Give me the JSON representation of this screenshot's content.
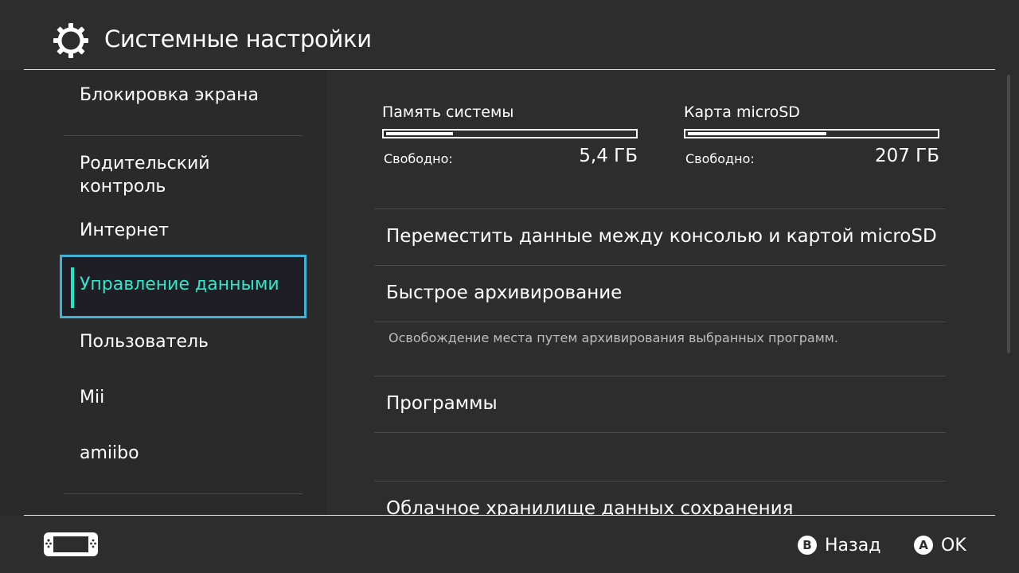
{
  "header": {
    "title": "Системные настройки",
    "icon": "gear-icon"
  },
  "sidebar": {
    "items": [
      {
        "label": "Блокировка экрана"
      },
      {
        "label": "Родительский\nконтроль"
      },
      {
        "label": "Интернет"
      },
      {
        "label": "Управление данными",
        "selected": true
      },
      {
        "label": "Пользователь"
      },
      {
        "label": "Mii"
      },
      {
        "label": "amiibo"
      }
    ]
  },
  "storage": {
    "system": {
      "title": "Память системы",
      "free_label": "Свободно:",
      "free_value": "5,4 ГБ",
      "used_fraction": 0.27
    },
    "sd": {
      "title": "Карта microSD",
      "free_label": "Свободно:",
      "free_value": "207 ГБ",
      "used_fraction": 0.56
    }
  },
  "menu": {
    "move_data": "Переместить данные между консолью и картой microSD",
    "quick_archive": "Быстрое архивирование",
    "quick_archive_desc": "Освобождение места путем архивирования выбранных программ.",
    "programs": "Программы",
    "cloud_saves": "Облачное хранилище данных сохранения"
  },
  "footer": {
    "back": {
      "button": "B",
      "label": "Назад"
    },
    "ok": {
      "button": "A",
      "label": "OK"
    }
  },
  "colors": {
    "background": "#2d2d2d",
    "selection_border": "#3fb3d6",
    "selection_text": "#2ee8cb"
  }
}
